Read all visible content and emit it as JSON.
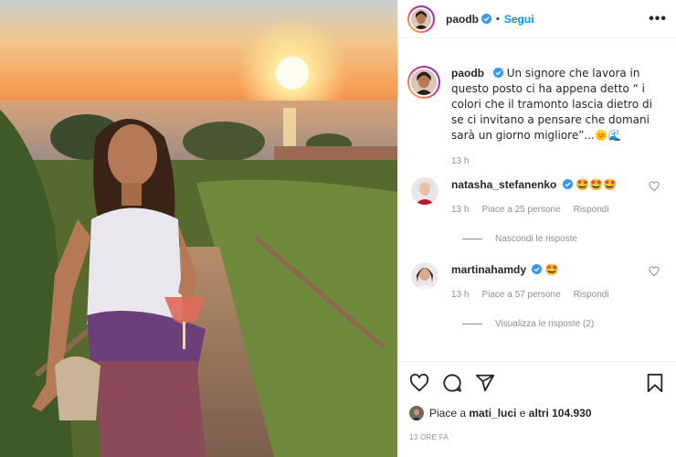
{
  "post": {
    "username": "paodb",
    "follow_label": "Segui",
    "more_label": "•••",
    "caption": "Un signore che lavora in questo posto ci ha appena detto “ i colori che il tramonto lascia dietro di se ci invitano a pensare che domani sarà un giorno migliore”...🌞🌊",
    "caption_time": "13 h"
  },
  "comments": [
    {
      "username": "natasha_stefanenko",
      "text": "🤩🤩🤩",
      "time": "13 h",
      "likes": "Piace a 25 persone",
      "reply": "Rispondi",
      "replies_label": "Nascondi le risposte"
    },
    {
      "username": "martinahamdy",
      "text": "🤩",
      "time": "13 h",
      "likes": "Piace a 57 persone",
      "reply": "Rispondi",
      "replies_label": "Visualizza le risposte (2)"
    }
  ],
  "footer": {
    "likes_prefix": "Piace a ",
    "likes_user": "mati_luci",
    "likes_mid": " e ",
    "likes_others": "altri 104.930",
    "timestamp": "13 ORE FA"
  },
  "colors": {
    "link": "#0095f6",
    "verified": "#3897f0",
    "muted": "#8e8e8e"
  },
  "icons": [
    "heart-icon",
    "comment-icon",
    "share-icon",
    "bookmark-icon",
    "verified-icon",
    "more-icon"
  ]
}
